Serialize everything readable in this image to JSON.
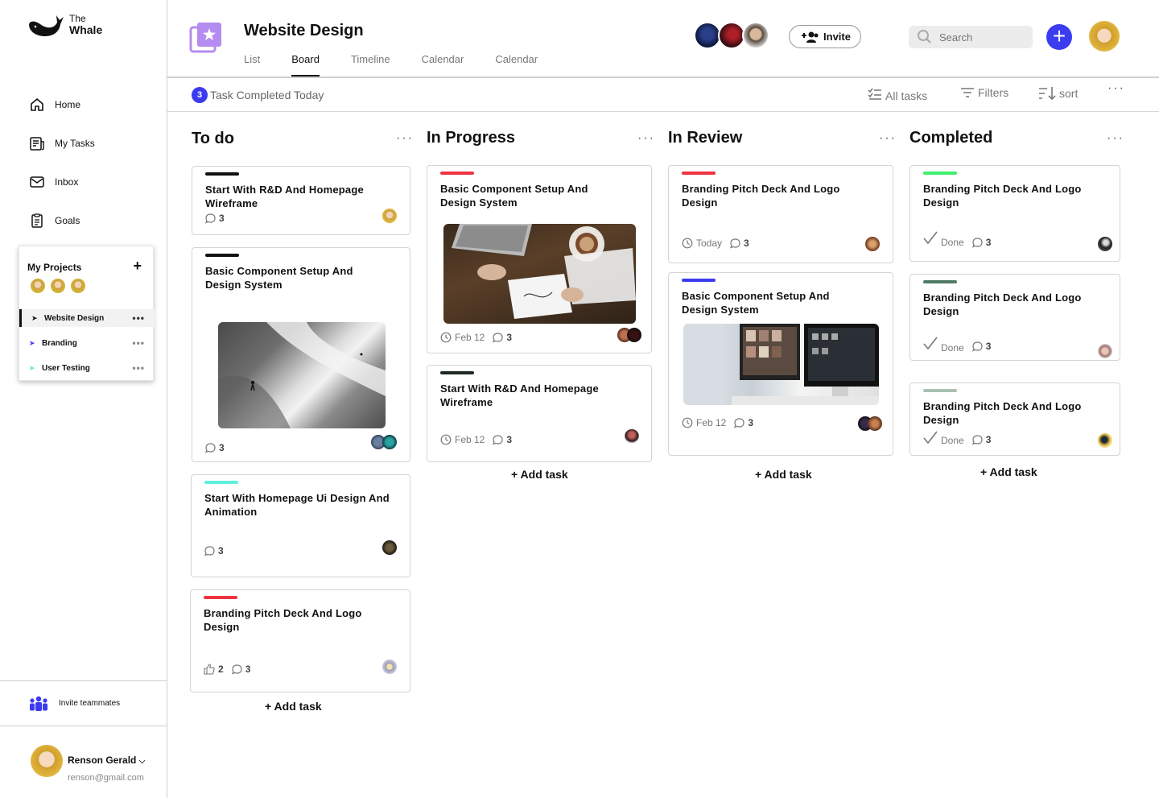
{
  "app": {
    "name_top": "The",
    "name_bottom": "Whale"
  },
  "nav": {
    "home": "Home",
    "my_tasks": "My Tasks",
    "inbox": "Inbox",
    "goals": "Goals"
  },
  "projects": {
    "title": "My Projects",
    "items": [
      {
        "name": "Website Design",
        "color": "#111111"
      },
      {
        "name": "Branding",
        "color": "#3b3bf0"
      },
      {
        "name": "User Testing",
        "color": "#5ee6d6"
      }
    ]
  },
  "invite_teammates": "Invite teammates",
  "user": {
    "name": "Renson Gerald",
    "email": "renson@gmail.com"
  },
  "header": {
    "title": "Website Design",
    "tabs": [
      "List",
      "Board",
      "Timeline",
      "Calendar",
      "Calendar"
    ],
    "active_tab": "Board",
    "invite": "Invite",
    "search_placeholder": "Search"
  },
  "subbar": {
    "completed_count": "3",
    "completed_text": "Task Completed Today",
    "all_tasks": "All tasks",
    "filters": "Filters",
    "sort": "sort"
  },
  "columns": {
    "todo": {
      "title": "To do",
      "add": "+ Add task",
      "cards": [
        {
          "title": "Start With R&D And Homepage Wireframe",
          "comments": "3",
          "color": "#111111"
        },
        {
          "title": "Basic Component Setup And Design System",
          "comments": "3",
          "color": "#111111"
        },
        {
          "title": "Start With Homepage Ui Design And Animation",
          "comments": "3",
          "color": "#5ef0dc"
        },
        {
          "title": "Branding Pitch Deck And Logo Design",
          "likes": "2",
          "comments": "3",
          "color": "#ef3340"
        }
      ]
    },
    "progress": {
      "title": "In Progress",
      "add": "+ Add task",
      "cards": [
        {
          "title": "Basic Component Setup And Design System",
          "date": "Feb 12",
          "comments": "3",
          "color": "#ef3340"
        },
        {
          "title": "Start With R&D And Homepage Wireframe",
          "date": "Feb 12",
          "comments": "3",
          "color": "#1f2a22"
        }
      ]
    },
    "review": {
      "title": "In Review",
      "add": "+ Add task",
      "cards": [
        {
          "title": "Branding Pitch Deck And Logo Design",
          "date": "Today",
          "comments": "3",
          "color": "#ef3340"
        },
        {
          "title": "Basic Component Setup And Design System",
          "date": "Feb 12",
          "comments": "3",
          "color": "#3b3bf0"
        }
      ]
    },
    "completed": {
      "title": "Completed",
      "add": "+ Add task",
      "cards": [
        {
          "title": "Branding Pitch Deck And Logo Design",
          "status": "Done",
          "comments": "3",
          "color": "#3ef06a"
        },
        {
          "title": "Branding Pitch Deck And Logo Design",
          "status": "Done",
          "comments": "3",
          "color": "#4f7a66"
        },
        {
          "title": "Branding Pitch Deck And Logo Design",
          "status": "Done",
          "comments": "3",
          "color": "#a9c2b0"
        }
      ]
    }
  }
}
